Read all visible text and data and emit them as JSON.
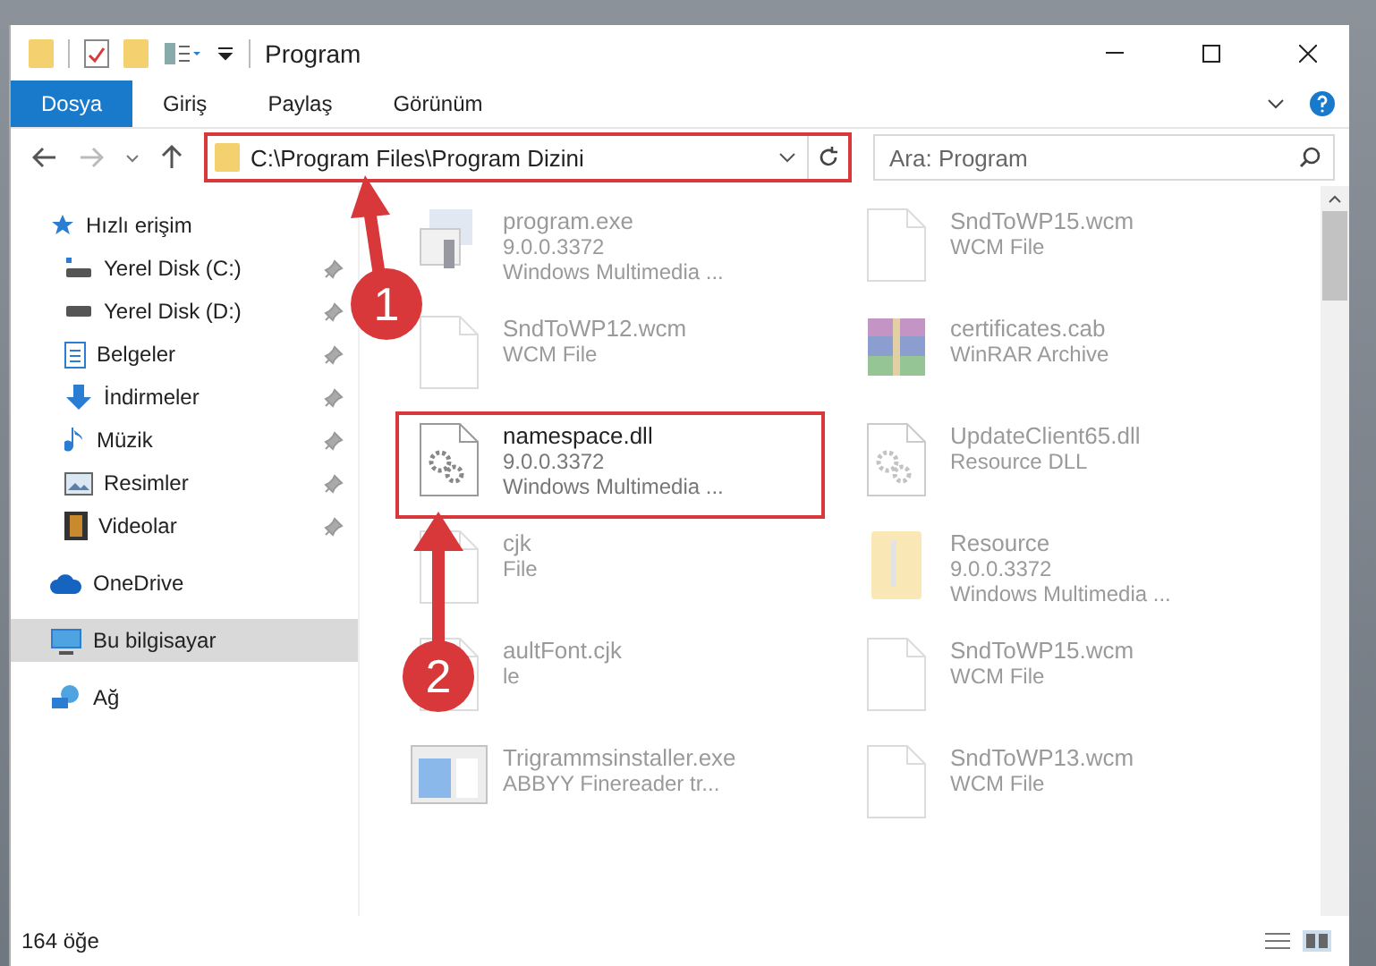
{
  "window": {
    "title": "Program"
  },
  "ribbon_tabs": [
    {
      "label": "Dosya",
      "selected": true
    },
    {
      "label": "Giriş",
      "selected": false
    },
    {
      "label": "Paylaş",
      "selected": false
    },
    {
      "label": "Görünüm",
      "selected": false
    }
  ],
  "address_bar": {
    "path": "C:\\Program Files\\Program Dizini",
    "highlighted": true
  },
  "search": {
    "placeholder": "Ara: Program"
  },
  "sidebar": {
    "items": [
      {
        "label": "Hızlı erişim",
        "kind": "star",
        "selected": false,
        "children": [
          {
            "label": "Yerel Disk (C:)",
            "kind": "drive-c",
            "pinned": true,
            "selected": false
          },
          {
            "label": "Yerel Disk (D:)",
            "kind": "drive",
            "pinned": true,
            "selected": false
          },
          {
            "label": "Belgeler",
            "kind": "document",
            "pinned": true,
            "selected": false
          },
          {
            "label": "İndirmeler",
            "kind": "download",
            "pinned": true,
            "selected": false
          },
          {
            "label": "Müzik",
            "kind": "music",
            "pinned": true,
            "selected": false
          },
          {
            "label": "Resimler",
            "kind": "picture",
            "pinned": true,
            "selected": false
          },
          {
            "label": "Videolar",
            "kind": "video",
            "pinned": true,
            "selected": false
          }
        ]
      },
      {
        "label": "OneDrive",
        "kind": "cloud",
        "selected": false
      },
      {
        "label": "Bu bilgisayar",
        "kind": "computer",
        "selected": true
      },
      {
        "label": "Ağ",
        "kind": "network",
        "selected": false
      }
    ]
  },
  "files": [
    {
      "name": "program.exe",
      "details": [
        "9.0.0.3372",
        "Windows Multimedia ..."
      ],
      "kind": "exe",
      "faded": true,
      "highlighted": false
    },
    {
      "name": "SndToWP15.wcm",
      "details": [
        "WCM File"
      ],
      "kind": "blank",
      "faded": true,
      "highlighted": false
    },
    {
      "name": "SndToWP12.wcm",
      "details": [
        "WCM File"
      ],
      "kind": "blank",
      "faded": true,
      "highlighted": false
    },
    {
      "name": "certificates.cab",
      "details": [
        "WinRAR Archive"
      ],
      "kind": "archive",
      "faded": true,
      "highlighted": false
    },
    {
      "name": "namespace.dll",
      "details": [
        "9.0.0.3372",
        "Windows Multimedia ..."
      ],
      "kind": "dll",
      "faded": false,
      "highlighted": true
    },
    {
      "name": "UpdateClient65.dll",
      "details": [
        "Resource DLL"
      ],
      "kind": "dll",
      "faded": true,
      "highlighted": false
    },
    {
      "name": "cjk",
      "details": [
        "File"
      ],
      "kind": "blank",
      "faded": true,
      "highlighted": false
    },
    {
      "name": "Resource",
      "details": [
        "9.0.0.3372",
        "Windows Multimedia ..."
      ],
      "kind": "folder",
      "faded": true,
      "highlighted": false
    },
    {
      "name": "aultFont.cjk",
      "details": [
        "le"
      ],
      "kind": "blank",
      "faded": true,
      "highlighted": false
    },
    {
      "name": "SndToWP15.wcm",
      "details": [
        "WCM File"
      ],
      "kind": "blank",
      "faded": true,
      "highlighted": false
    },
    {
      "name": "Trigrammsinstaller.exe",
      "details": [
        "ABBYY Finereader tr..."
      ],
      "kind": "installer",
      "faded": true,
      "highlighted": false
    },
    {
      "name": "SndToWP13.wcm",
      "details": [
        "WCM File"
      ],
      "kind": "blank",
      "faded": true,
      "highlighted": false
    }
  ],
  "callouts": [
    {
      "number": "1"
    },
    {
      "number": "2"
    }
  ],
  "status_bar": {
    "count": "164 öğe"
  }
}
